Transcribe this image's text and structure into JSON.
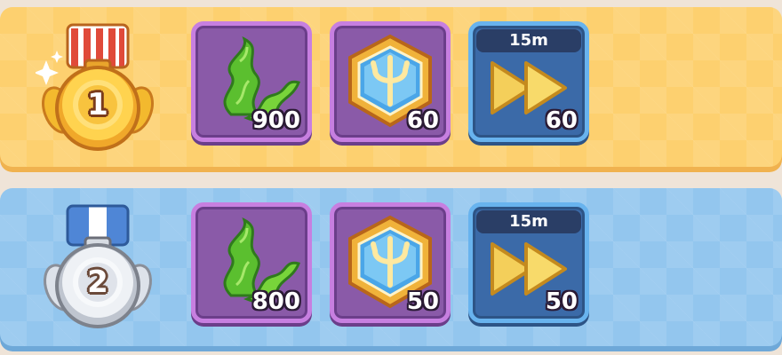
{
  "colors": {
    "gold_row": "#fdd06f",
    "silver_row": "#93c6ee",
    "purple_frame": "#8a5aa8",
    "blue_frame": "#3b6aa8"
  },
  "rows": [
    {
      "rank": "1",
      "medal_icon": "gold-medal-icon",
      "rewards": [
        {
          "icon": "seaweed-icon",
          "quantity": "900"
        },
        {
          "icon": "trident-hexagon-icon",
          "quantity": "60"
        },
        {
          "icon": "fast-forward-icon",
          "time": "15m",
          "quantity": "60"
        }
      ]
    },
    {
      "rank": "2",
      "medal_icon": "silver-medal-icon",
      "rewards": [
        {
          "icon": "seaweed-icon",
          "quantity": "800"
        },
        {
          "icon": "trident-hexagon-icon",
          "quantity": "50"
        },
        {
          "icon": "fast-forward-icon",
          "time": "15m",
          "quantity": "50"
        }
      ]
    }
  ]
}
